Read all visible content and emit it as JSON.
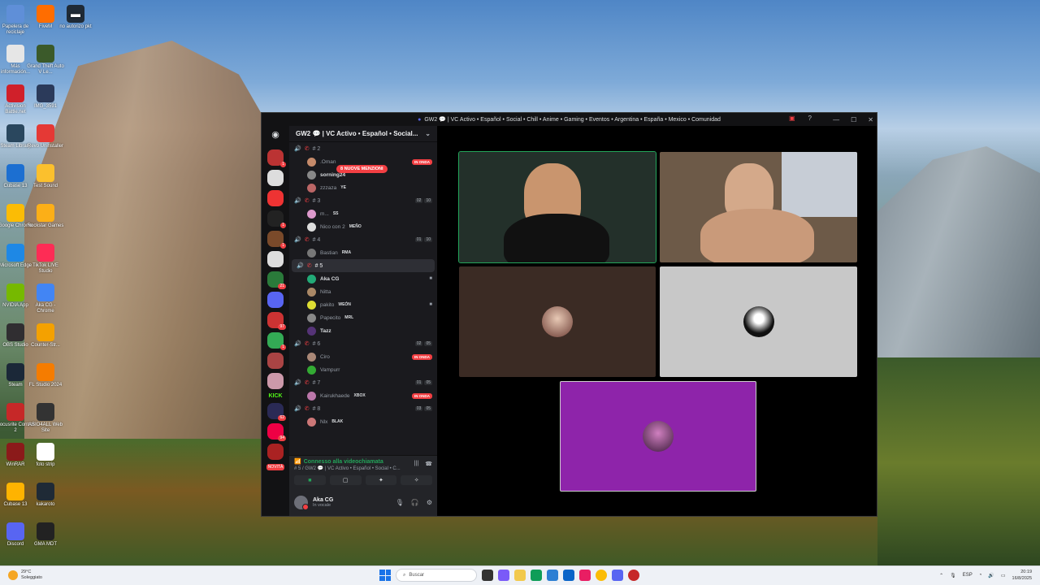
{
  "desktop": {
    "icons_col1": [
      "Papelera de reciclaje",
      "Más información...",
      "Activision Battle.net",
      "Steam Library",
      "Cubase 13",
      "Google Chrome",
      "Microsoft Edge",
      "NVIDIA App",
      "OBS Studio",
      "Steam",
      "Focusrite Control 2",
      "WinRAR",
      "Cubase 13",
      "Discord"
    ],
    "icons_col2": [
      "FiveM",
      "Grand Theft Auto V Le...",
      "IMG_3591",
      "Revo Uninstaller",
      "Test Sound",
      "Rockstar Games",
      "TikTok LIVE Studio",
      "Aka CG - Chrome",
      "Counter-Str...",
      "FL Studio 2024",
      "ASIO4ALL Web Site",
      "foto strip",
      "kakaroto",
      "GMA MDT"
    ],
    "icon_col3": "no autorizo pkt"
  },
  "window": {
    "title": "GW2 💬 | VC Activo • Español • Social • Chill • Anime • Gaming • Eventos • Argentina • España • Mexico • Comunidad"
  },
  "guilds": {
    "badges": [
      "1",
      "",
      "",
      "1",
      "1",
      "",
      "21",
      "",
      "97",
      "1",
      "",
      "",
      "",
      "62",
      "94",
      ""
    ],
    "kick_label": "KICK",
    "new_label": "NOVITÀ"
  },
  "server": {
    "name": "GW2 💬 | VC Activo • Español • Social...",
    "mentions_pill": "8 NUOVE MENZIONI",
    "channels": [
      {
        "name": "# 2",
        "counter": [],
        "users": [
          {
            "name": ".Oman",
            "tag": "",
            "live": "IN ONDA"
          },
          {
            "name": "sorning24",
            "tag": "",
            "bright": true
          },
          {
            "name": "zzzaza",
            "tag": "YE"
          }
        ]
      },
      {
        "name": "# 3",
        "counter": [
          "02",
          "10"
        ],
        "users": [
          {
            "name": "m...",
            "tag": "SS"
          },
          {
            "name": "Nico con 2",
            "tag": "MEÑO"
          }
        ]
      },
      {
        "name": "# 4",
        "counter": [
          "01",
          "10"
        ],
        "users": [
          {
            "name": "Bastian",
            "tag": "RMA"
          }
        ]
      },
      {
        "name": "# 5",
        "counter": [],
        "active": true,
        "users": [
          {
            "name": "Aka CG",
            "tag": "",
            "bright": true,
            "cam": true
          },
          {
            "name": "Nitta",
            "tag": ""
          },
          {
            "name": "pakito",
            "tag": "WEÓN",
            "cam": true
          },
          {
            "name": "Papecito",
            "tag": "MRL"
          },
          {
            "name": "Tazz",
            "tag": "",
            "bright": true
          }
        ]
      },
      {
        "name": "# 6",
        "counter": [
          "02",
          "05"
        ],
        "users": [
          {
            "name": "Ciro",
            "tag": "",
            "live": "IN ONDA"
          },
          {
            "name": "Vampurr",
            "tag": ""
          }
        ]
      },
      {
        "name": "# 7",
        "counter": [
          "01",
          "05"
        ],
        "users": [
          {
            "name": "Kairukhaede",
            "tag": "XBOX",
            "live": "IN ONDA"
          }
        ]
      },
      {
        "name": "# 8",
        "counter": [
          "03",
          "05"
        ],
        "users": [
          {
            "name": "Nlx",
            "tag": "BLAK"
          }
        ]
      }
    ]
  },
  "voice": {
    "status": "Connesso alla videochiamata",
    "channel": "# 5 / GW2 💬 | VC Activo • Español • Social • C...",
    "user_name": "Aka CG",
    "user_sub": "In vocale"
  },
  "taskbar": {
    "weather_temp": "29°C",
    "weather_desc": "Soleggiato",
    "search_placeholder": "Buscar",
    "lang": "ESP",
    "time": "20:19",
    "date": "16/8/2025"
  },
  "colors": {
    "discord_bg": "#1a1a1e",
    "speaking_green": "#23a55a",
    "live_red": "#f23f43",
    "tile_brown": "#3b2b24",
    "tile_grey": "#c8c8c8",
    "tile_purple": "#8e24aa"
  }
}
